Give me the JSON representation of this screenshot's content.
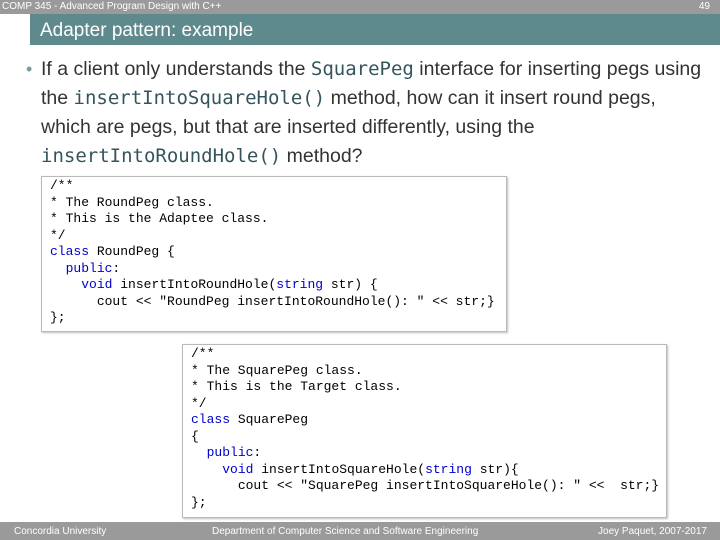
{
  "header": {
    "course": "COMP 345 - Advanced Program Design with C++",
    "page_number": "49"
  },
  "slide": {
    "title": "Adapter pattern: example",
    "bullet": {
      "part1": "If a client only understands the ",
      "code1": "SquarePeg",
      "part2": " interface for inserting pegs using the ",
      "code2": "insertIntoSquareHole()",
      "part3": " method, how can it insert round pegs, which are pegs, but that are inserted differently, using the ",
      "code3": "insertIntoRoundHole()",
      "part4": " method?"
    }
  },
  "code_round": {
    "c1": "/**",
    "c2": "* The RoundPeg class.",
    "c3": "* This is the Adaptee class.",
    "c4": "*/",
    "class_kw": "class",
    "class_name": " RoundPeg {",
    "public_kw": "public",
    "public_rest": ":",
    "void_kw": "void",
    "method_a": " insertIntoRoundHole(",
    "string_kw": "string",
    "method_b": " str) {",
    "body": "cout << \"RoundPeg insertIntoRoundHole(): \" << str;}",
    "end": "};"
  },
  "code_square": {
    "c1": "/**",
    "c2": "* The SquarePeg class.",
    "c3": "* This is the Target class.",
    "c4": "*/",
    "class_kw": "class",
    "class_name": " SquarePeg",
    "brace": "{",
    "public_kw": "public",
    "public_rest": ":",
    "void_kw": "void",
    "method_a": " insertIntoSquareHole(",
    "string_kw": "string",
    "method_b": " str){",
    "body": "cout << \"SquarePeg insertIntoSquareHole(): \" <<  str;}",
    "end": "};"
  },
  "footer": {
    "left": "Concordia University",
    "center": "Department of Computer Science and Software Engineering",
    "right": "Joey Paquet, 2007-2017"
  }
}
